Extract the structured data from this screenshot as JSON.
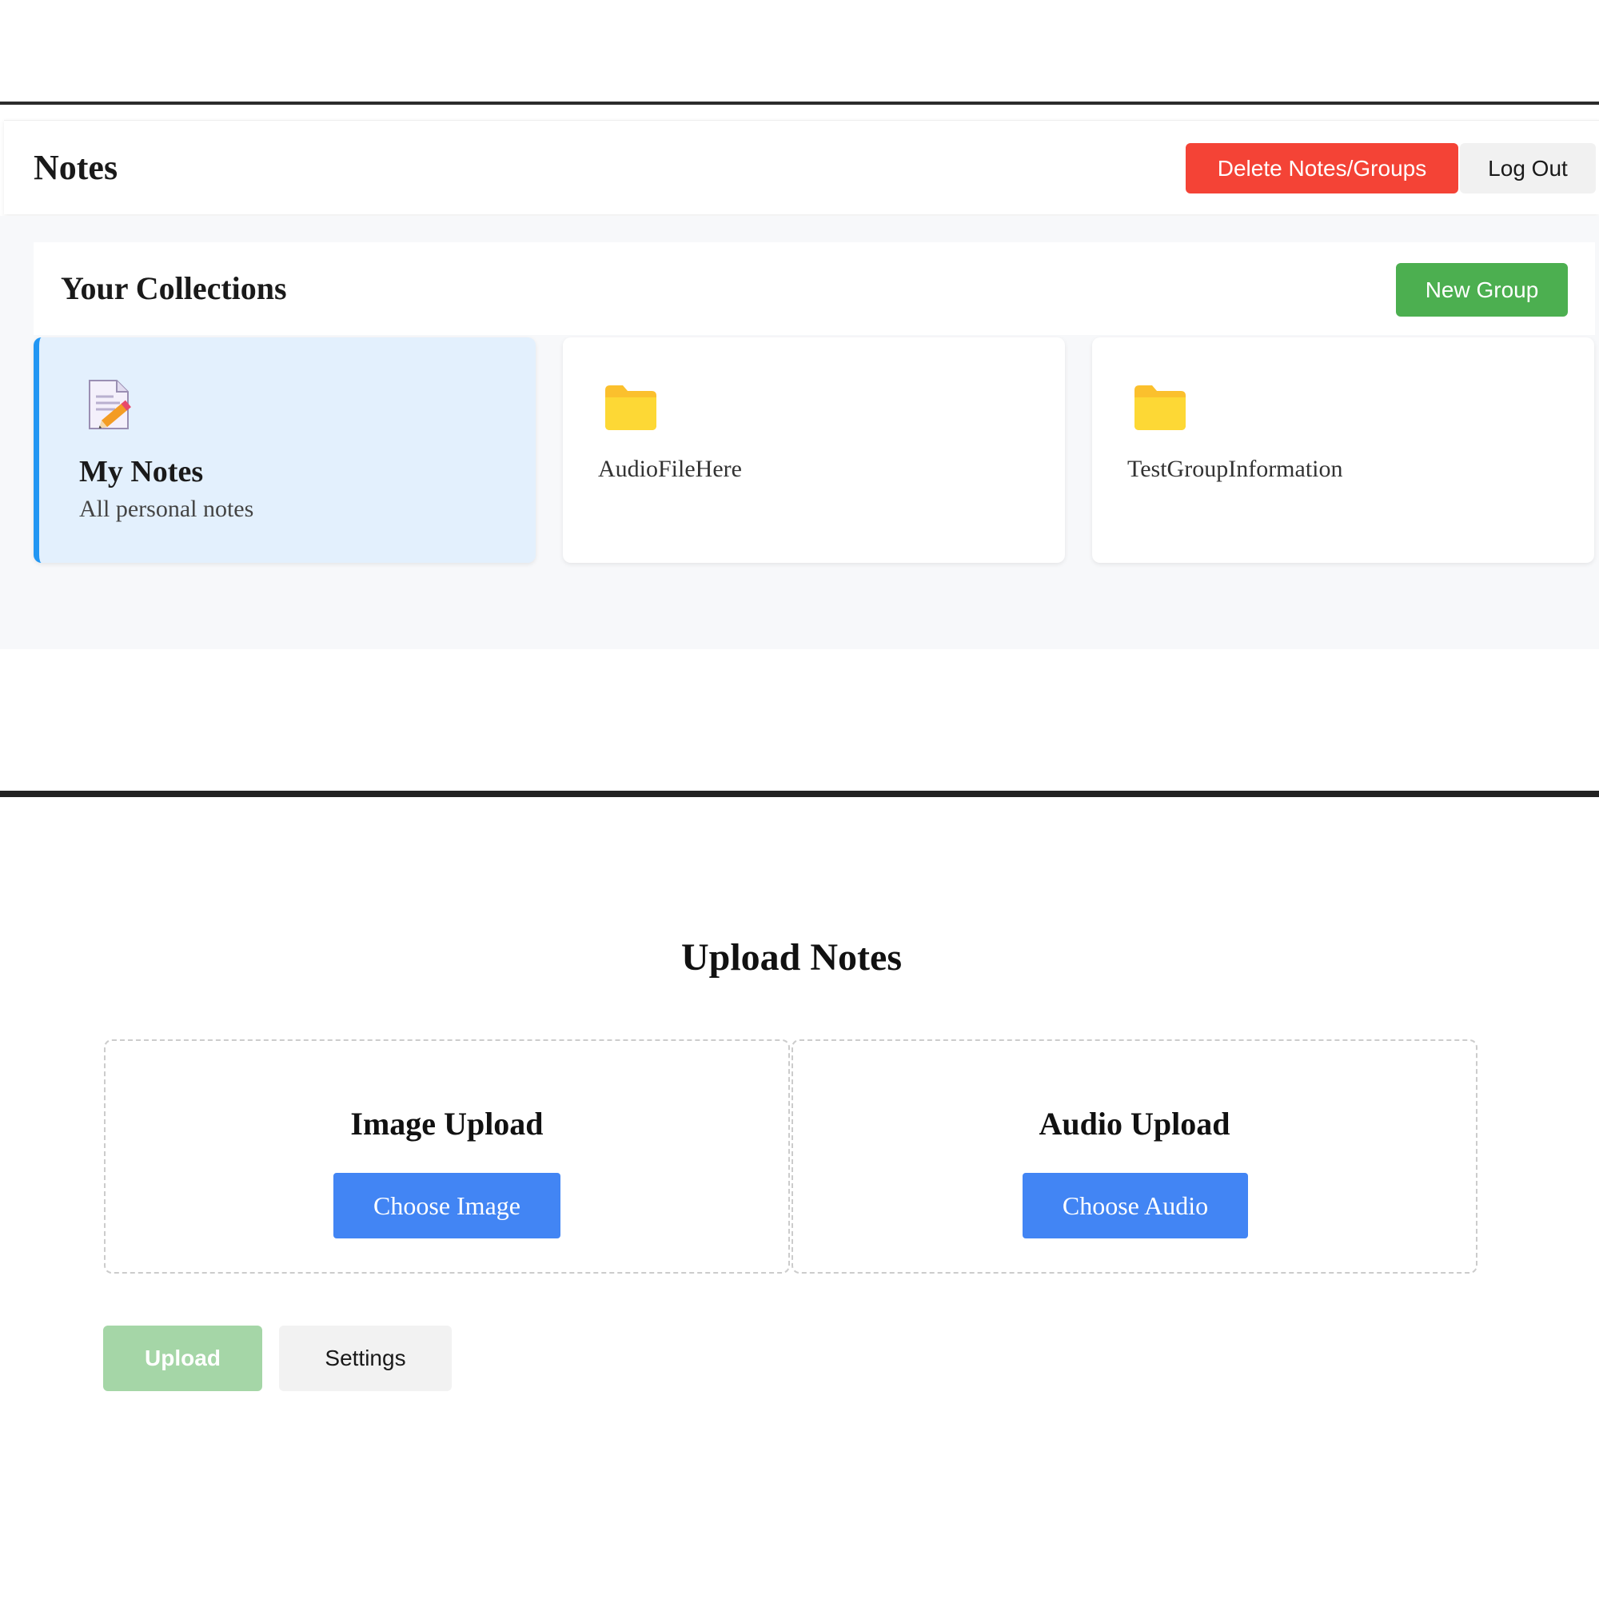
{
  "header": {
    "title": "Notes",
    "delete_label": "Delete Notes/Groups",
    "logout_label": "Log Out"
  },
  "collections": {
    "title": "Your Collections",
    "new_group_label": "New Group",
    "cards": [
      {
        "name": "My Notes",
        "subtitle": "All personal notes",
        "icon": "note-pencil-icon",
        "selected": true
      },
      {
        "name": "AudioFileHere",
        "icon": "folder-icon"
      },
      {
        "name": "TestGroupInformation",
        "icon": "folder-icon"
      }
    ]
  },
  "upload": {
    "title": "Upload Notes",
    "image": {
      "title": "Image Upload",
      "button": "Choose Image"
    },
    "audio": {
      "title": "Audio Upload",
      "button": "Choose Audio"
    },
    "upload_label": "Upload",
    "settings_label": "Settings"
  },
  "colors": {
    "delete": "#f44336",
    "new_group": "#4caf50",
    "selected_card_bg": "#e3f0fd",
    "selected_card_border": "#2196f3",
    "choose_button": "#4285f4",
    "upload_disabled": "#a5d6a7",
    "folder": "#fdd835"
  }
}
